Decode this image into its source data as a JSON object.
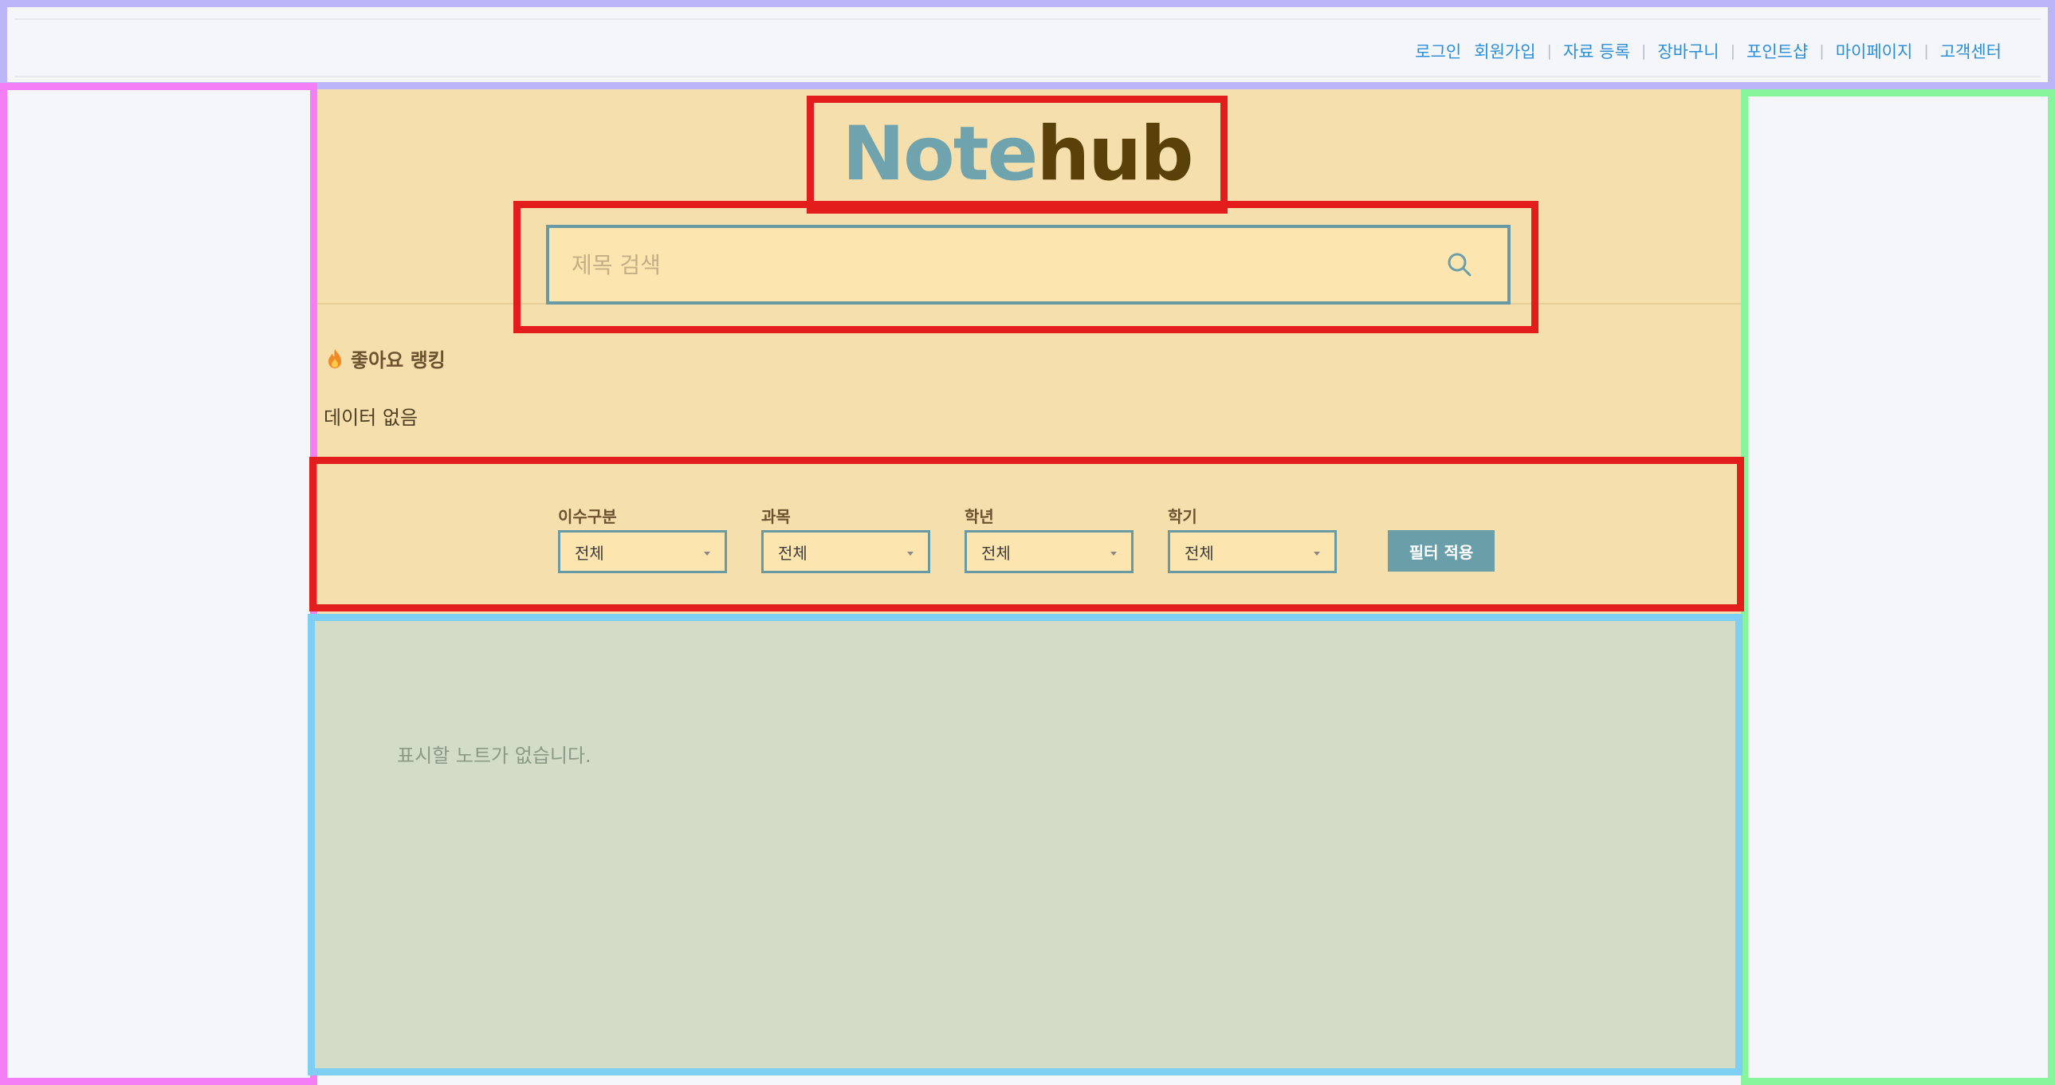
{
  "nav": {
    "login": "로그인",
    "signup": "회원가입",
    "upload": "자료 등록",
    "cart": "장바구니",
    "point_shop": "포인트샵",
    "mypage": "마이페이지",
    "support": "고객센터",
    "separator": "|"
  },
  "logo": {
    "part1": "Note",
    "part2": "hub",
    "colors": {
      "note": "#6fa4ae",
      "hub": "#5a4009"
    }
  },
  "search": {
    "placeholder": "제목 검색",
    "value": "",
    "icon": "search-icon"
  },
  "ranking": {
    "icon": "fire-icon",
    "title": "좋아요 랭킹",
    "empty_text": "데이터 없음"
  },
  "filters": [
    {
      "label": "이수구분",
      "selected": "전체"
    },
    {
      "label": "과목",
      "selected": "전체"
    },
    {
      "label": "학년",
      "selected": "전체"
    },
    {
      "label": "학기",
      "selected": "전체"
    }
  ],
  "apply_label": "필터 적용",
  "notes": {
    "empty_text": "표시할 노트가 없습니다."
  },
  "colors": {
    "content_bg": "#f5dfad",
    "accent": "#6a9ea8",
    "notes_bg": "#d3dcc6",
    "link": "#2b8fd8"
  }
}
